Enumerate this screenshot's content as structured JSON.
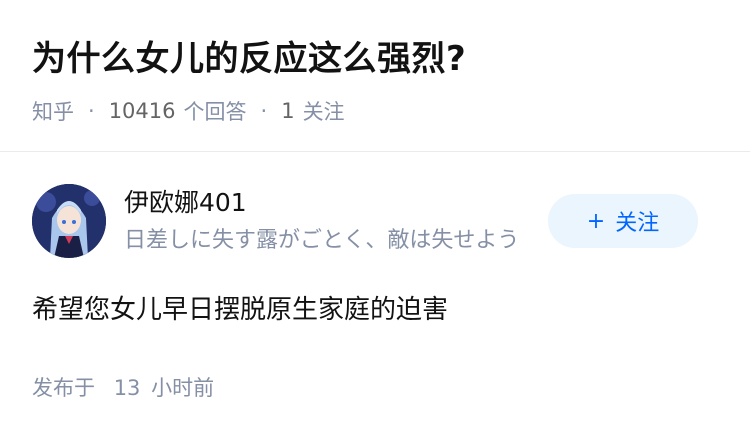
{
  "question": {
    "title": "为什么女儿的反应这么强烈?",
    "source": "知乎",
    "answer_count": "10416",
    "answer_label": "个回答",
    "follower_count": "1",
    "follower_label": "关注"
  },
  "author": {
    "name": "伊欧娜401",
    "bio": "日差しに失す露がごとく、敵は失せよう",
    "follow_label": "关注",
    "avatar_icon": "anime-avatar"
  },
  "answer": {
    "text": "希望您女儿早日摆脱原生家庭的迫害"
  },
  "footer": {
    "published_prefix": "发布于",
    "published_num": "13",
    "published_unit": "小时前"
  },
  "colors": {
    "accent": "#0066ff",
    "follow_bg": "#ebf5fd",
    "muted": "#8590a6"
  }
}
